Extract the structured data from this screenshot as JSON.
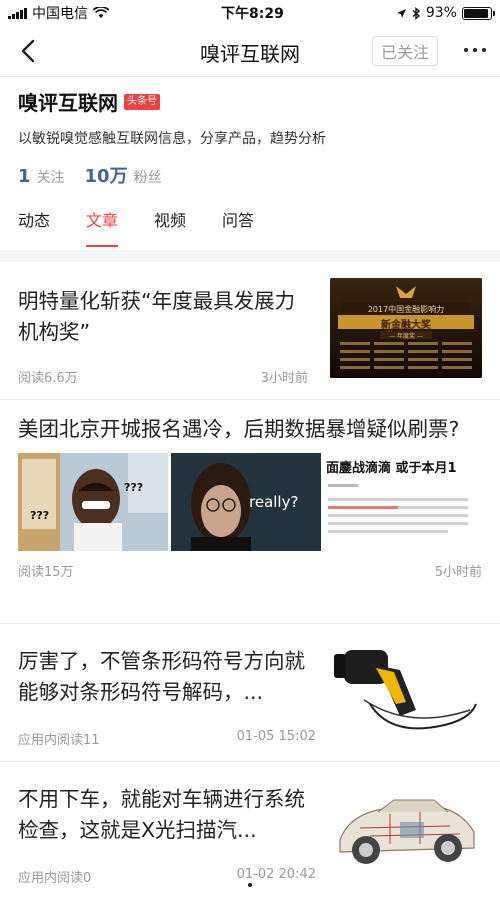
{
  "status": {
    "carrier": "中国电信",
    "time": "下午8:29",
    "battery": "93%"
  },
  "nav": {
    "title": "嗅评互联网",
    "follow_state": "已关注"
  },
  "profile": {
    "name": "嗅评互联网",
    "badge": "头条号",
    "description": "以敏锐嗅觉感触互联网信息，分享产品，趋势分析",
    "follow_count": "1",
    "follow_label": "关注",
    "fans_count": "10万",
    "fans_label": "粉丝"
  },
  "tabs": [
    {
      "label": "动态"
    },
    {
      "label": "文章"
    },
    {
      "label": "视频"
    },
    {
      "label": "问答"
    }
  ],
  "articles": [
    {
      "title": "明特量化斩获“年度最具发展力机构奖”",
      "reads": "阅读6.6万",
      "time": "3小时前",
      "thumb": {
        "banner_title": "2017中国金融影响力",
        "award": "新金融大奖",
        "sub": "— 年度奖 —"
      }
    },
    {
      "title": "美团北京开城报名遇冷，后期数据暴增疑似刷票?",
      "reads": "阅读15万",
      "time": "5小时前",
      "images": [
        {
          "text": "???"
        },
        {
          "text": "really?"
        },
        {
          "headline": "面鏖战滴滴 或于本月1"
        }
      ]
    },
    {
      "title": "厉害了，不管条形码符号方向就能够对条形码符号解码，...",
      "reads": "应用内阅读11",
      "time": "01-05 15:02"
    },
    {
      "title": "不用下车，就能对车辆进行系统检查，这就是X光扫描汽...",
      "reads": "应用内阅读0",
      "time": "01-02 20:42"
    }
  ]
}
